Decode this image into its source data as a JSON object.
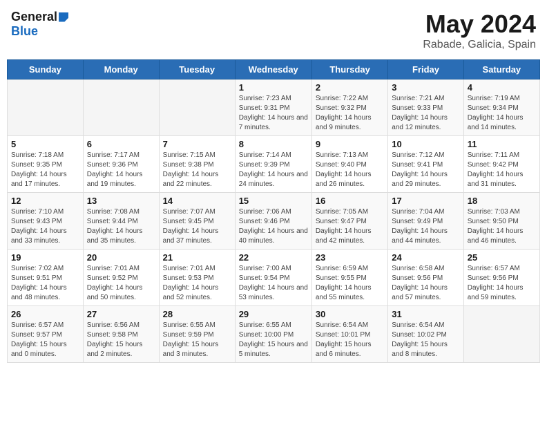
{
  "header": {
    "logo_general": "General",
    "logo_blue": "Blue",
    "title": "May 2024",
    "subtitle": "Rabade, Galicia, Spain"
  },
  "weekdays": [
    "Sunday",
    "Monday",
    "Tuesday",
    "Wednesday",
    "Thursday",
    "Friday",
    "Saturday"
  ],
  "weeks": [
    [
      {
        "day": "",
        "info": ""
      },
      {
        "day": "",
        "info": ""
      },
      {
        "day": "",
        "info": ""
      },
      {
        "day": "1",
        "info": "Sunrise: 7:23 AM\nSunset: 9:31 PM\nDaylight: 14 hours\nand 7 minutes."
      },
      {
        "day": "2",
        "info": "Sunrise: 7:22 AM\nSunset: 9:32 PM\nDaylight: 14 hours\nand 9 minutes."
      },
      {
        "day": "3",
        "info": "Sunrise: 7:21 AM\nSunset: 9:33 PM\nDaylight: 14 hours\nand 12 minutes."
      },
      {
        "day": "4",
        "info": "Sunrise: 7:19 AM\nSunset: 9:34 PM\nDaylight: 14 hours\nand 14 minutes."
      }
    ],
    [
      {
        "day": "5",
        "info": "Sunrise: 7:18 AM\nSunset: 9:35 PM\nDaylight: 14 hours\nand 17 minutes."
      },
      {
        "day": "6",
        "info": "Sunrise: 7:17 AM\nSunset: 9:36 PM\nDaylight: 14 hours\nand 19 minutes."
      },
      {
        "day": "7",
        "info": "Sunrise: 7:15 AM\nSunset: 9:38 PM\nDaylight: 14 hours\nand 22 minutes."
      },
      {
        "day": "8",
        "info": "Sunrise: 7:14 AM\nSunset: 9:39 PM\nDaylight: 14 hours\nand 24 minutes."
      },
      {
        "day": "9",
        "info": "Sunrise: 7:13 AM\nSunset: 9:40 PM\nDaylight: 14 hours\nand 26 minutes."
      },
      {
        "day": "10",
        "info": "Sunrise: 7:12 AM\nSunset: 9:41 PM\nDaylight: 14 hours\nand 29 minutes."
      },
      {
        "day": "11",
        "info": "Sunrise: 7:11 AM\nSunset: 9:42 PM\nDaylight: 14 hours\nand 31 minutes."
      }
    ],
    [
      {
        "day": "12",
        "info": "Sunrise: 7:10 AM\nSunset: 9:43 PM\nDaylight: 14 hours\nand 33 minutes."
      },
      {
        "day": "13",
        "info": "Sunrise: 7:08 AM\nSunset: 9:44 PM\nDaylight: 14 hours\nand 35 minutes."
      },
      {
        "day": "14",
        "info": "Sunrise: 7:07 AM\nSunset: 9:45 PM\nDaylight: 14 hours\nand 37 minutes."
      },
      {
        "day": "15",
        "info": "Sunrise: 7:06 AM\nSunset: 9:46 PM\nDaylight: 14 hours\nand 40 minutes."
      },
      {
        "day": "16",
        "info": "Sunrise: 7:05 AM\nSunset: 9:47 PM\nDaylight: 14 hours\nand 42 minutes."
      },
      {
        "day": "17",
        "info": "Sunrise: 7:04 AM\nSunset: 9:49 PM\nDaylight: 14 hours\nand 44 minutes."
      },
      {
        "day": "18",
        "info": "Sunrise: 7:03 AM\nSunset: 9:50 PM\nDaylight: 14 hours\nand 46 minutes."
      }
    ],
    [
      {
        "day": "19",
        "info": "Sunrise: 7:02 AM\nSunset: 9:51 PM\nDaylight: 14 hours\nand 48 minutes."
      },
      {
        "day": "20",
        "info": "Sunrise: 7:01 AM\nSunset: 9:52 PM\nDaylight: 14 hours\nand 50 minutes."
      },
      {
        "day": "21",
        "info": "Sunrise: 7:01 AM\nSunset: 9:53 PM\nDaylight: 14 hours\nand 52 minutes."
      },
      {
        "day": "22",
        "info": "Sunrise: 7:00 AM\nSunset: 9:54 PM\nDaylight: 14 hours\nand 53 minutes."
      },
      {
        "day": "23",
        "info": "Sunrise: 6:59 AM\nSunset: 9:55 PM\nDaylight: 14 hours\nand 55 minutes."
      },
      {
        "day": "24",
        "info": "Sunrise: 6:58 AM\nSunset: 9:56 PM\nDaylight: 14 hours\nand 57 minutes."
      },
      {
        "day": "25",
        "info": "Sunrise: 6:57 AM\nSunset: 9:56 PM\nDaylight: 14 hours\nand 59 minutes."
      }
    ],
    [
      {
        "day": "26",
        "info": "Sunrise: 6:57 AM\nSunset: 9:57 PM\nDaylight: 15 hours\nand 0 minutes."
      },
      {
        "day": "27",
        "info": "Sunrise: 6:56 AM\nSunset: 9:58 PM\nDaylight: 15 hours\nand 2 minutes."
      },
      {
        "day": "28",
        "info": "Sunrise: 6:55 AM\nSunset: 9:59 PM\nDaylight: 15 hours\nand 3 minutes."
      },
      {
        "day": "29",
        "info": "Sunrise: 6:55 AM\nSunset: 10:00 PM\nDaylight: 15 hours\nand 5 minutes."
      },
      {
        "day": "30",
        "info": "Sunrise: 6:54 AM\nSunset: 10:01 PM\nDaylight: 15 hours\nand 6 minutes."
      },
      {
        "day": "31",
        "info": "Sunrise: 6:54 AM\nSunset: 10:02 PM\nDaylight: 15 hours\nand 8 minutes."
      },
      {
        "day": "",
        "info": ""
      }
    ]
  ]
}
